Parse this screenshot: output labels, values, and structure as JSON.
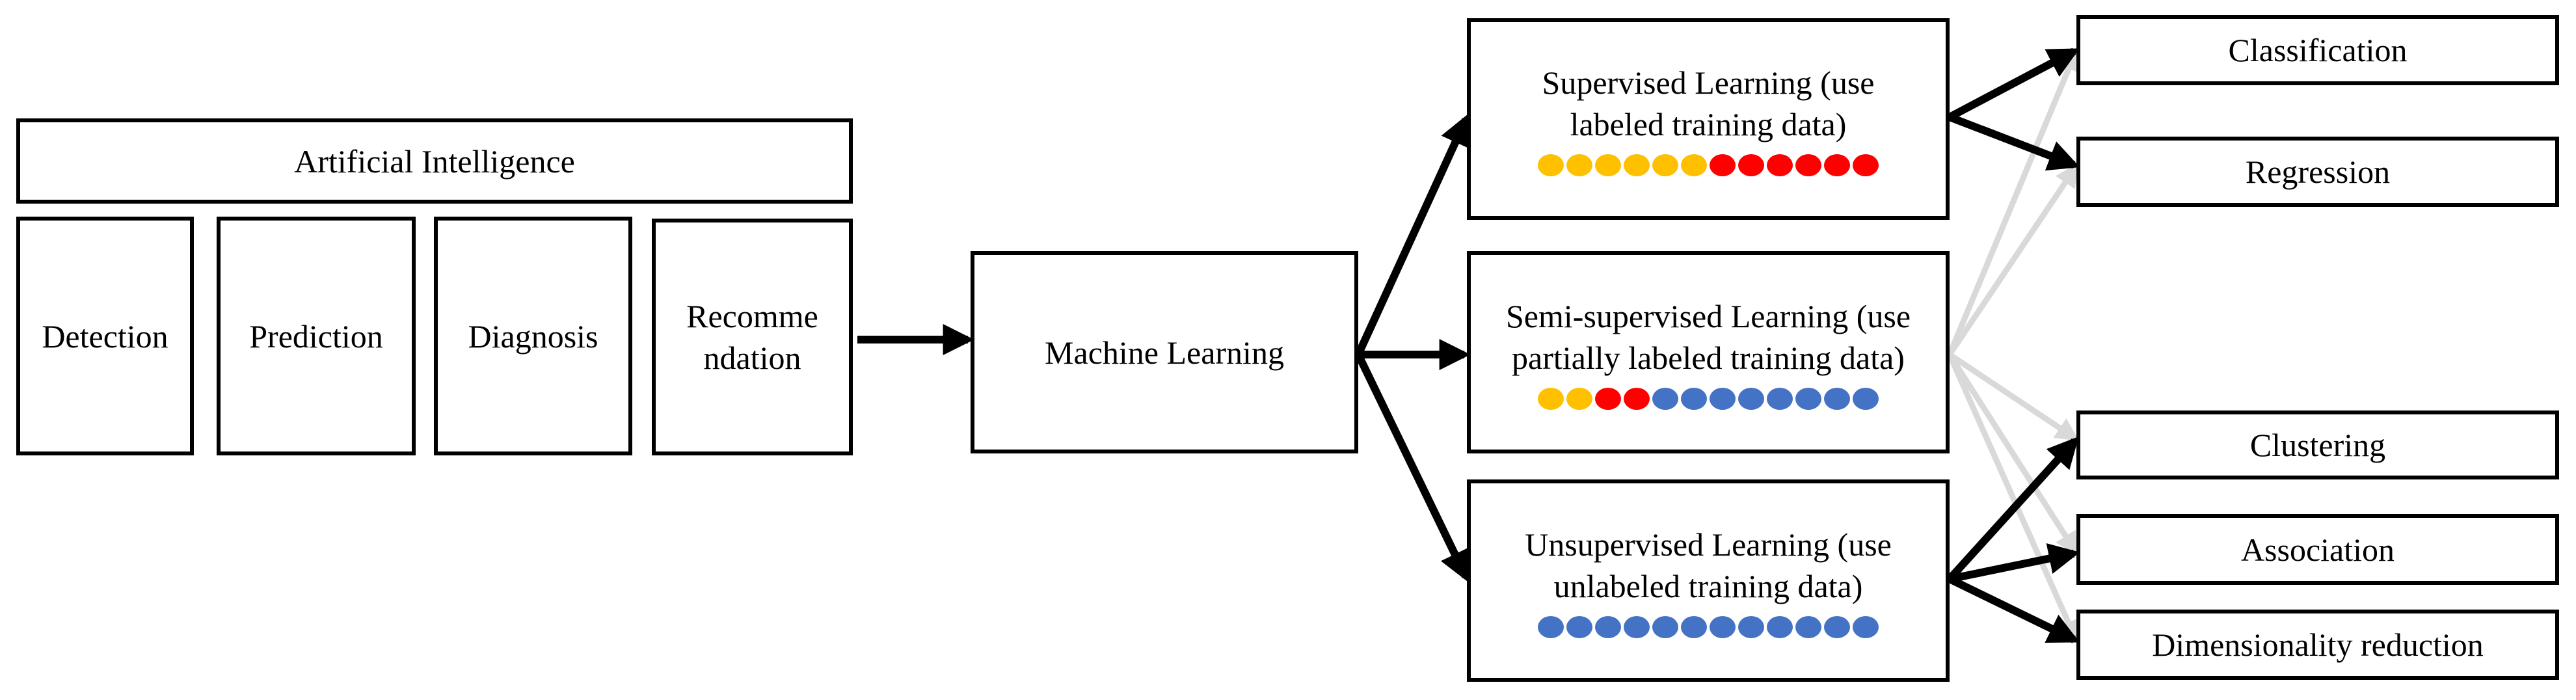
{
  "colors": {
    "labeled_class_a": "#FFC000",
    "labeled_class_b": "#FF0000",
    "unlabeled": "#4472C4",
    "primary_arrow": "#000000",
    "secondary_arrow": "#D9D9D9"
  },
  "ai": {
    "title": "Artificial Intelligence",
    "applications": [
      {
        "label": "Detection"
      },
      {
        "label": "Prediction"
      },
      {
        "label": "Diagnosis"
      },
      {
        "label": "Recomme ndation"
      }
    ]
  },
  "ml": {
    "label": "Machine Learning"
  },
  "paradigms": [
    {
      "id": "supervised",
      "label": "Supervised Learning (use labeled training data)",
      "dots": [
        "a",
        "a",
        "a",
        "a",
        "a",
        "a",
        "b",
        "b",
        "b",
        "b",
        "b",
        "b"
      ]
    },
    {
      "id": "semi",
      "label": "Semi-supervised Learning (use partially labeled training data)",
      "dots": [
        "a",
        "a",
        "b",
        "b",
        "u",
        "u",
        "u",
        "u",
        "u",
        "u",
        "u",
        "u"
      ]
    },
    {
      "id": "unsupervised",
      "label": "Unsupervised Learning (use unlabeled training data)",
      "dots": [
        "u",
        "u",
        "u",
        "u",
        "u",
        "u",
        "u",
        "u",
        "u",
        "u",
        "u",
        "u"
      ]
    }
  ],
  "tasks": [
    {
      "id": "classification",
      "label": "Classification"
    },
    {
      "id": "regression",
      "label": "Regression"
    },
    {
      "id": "clustering",
      "label": "Clustering"
    },
    {
      "id": "association",
      "label": "Association"
    },
    {
      "id": "dimensionality",
      "label": "Dimensionality reduction"
    }
  ],
  "edges": [
    {
      "from": "ai",
      "to": "ml",
      "style": "primary"
    },
    {
      "from": "ml",
      "to": "supervised",
      "style": "primary"
    },
    {
      "from": "ml",
      "to": "semi",
      "style": "primary"
    },
    {
      "from": "ml",
      "to": "unsupervised",
      "style": "primary"
    },
    {
      "from": "supervised",
      "to": "classification",
      "style": "primary"
    },
    {
      "from": "supervised",
      "to": "regression",
      "style": "primary"
    },
    {
      "from": "semi",
      "to": "classification",
      "style": "secondary"
    },
    {
      "from": "semi",
      "to": "regression",
      "style": "secondary"
    },
    {
      "from": "semi",
      "to": "clustering",
      "style": "secondary"
    },
    {
      "from": "semi",
      "to": "association",
      "style": "secondary"
    },
    {
      "from": "semi",
      "to": "dimensionality",
      "style": "secondary"
    },
    {
      "from": "unsupervised",
      "to": "clustering",
      "style": "primary"
    },
    {
      "from": "unsupervised",
      "to": "association",
      "style": "primary"
    },
    {
      "from": "unsupervised",
      "to": "dimensionality",
      "style": "primary"
    }
  ]
}
